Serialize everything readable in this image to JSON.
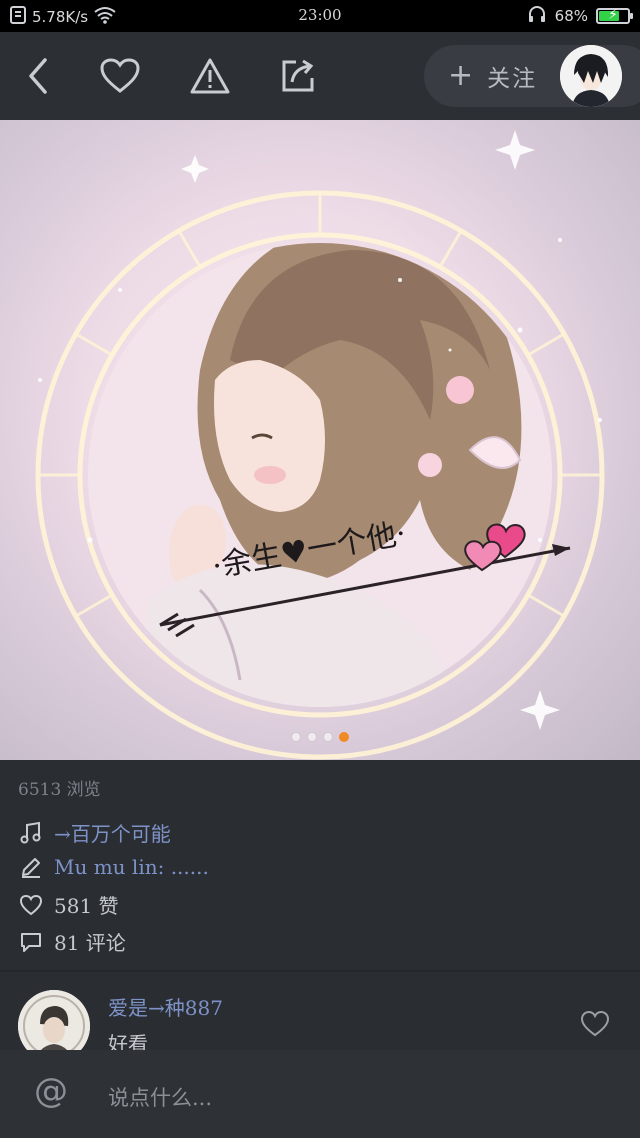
{
  "status_bar": {
    "network_speed": "5.78K/s",
    "time": "23:00",
    "battery": "68%",
    "battery_level": 0.68,
    "icons": [
      "doc-icon",
      "wifi-icon",
      "headset-icon",
      "battery-icon"
    ]
  },
  "nav": {
    "follow_label": "关注",
    "icons": [
      "back-icon",
      "heart-icon",
      "warning-icon",
      "share-icon",
      "plus-icon"
    ]
  },
  "image": {
    "caption": "·余生♥一个他·",
    "page_count": 4,
    "active_page": 4
  },
  "post": {
    "views": "6513 浏览",
    "music": "→百万个可能",
    "author_line": "Mu mu lin: ......",
    "likes": "581 赞",
    "comments": "81 评论"
  },
  "comment": {
    "username": "爱是→种887",
    "text": "好看"
  },
  "input": {
    "at_symbol": "@",
    "placeholder": "说点什么..."
  },
  "colors": {
    "background": "#2a2d32",
    "link": "#7d93c8",
    "active_dot": "#f08a24",
    "battery_fill": "#35d04a"
  }
}
